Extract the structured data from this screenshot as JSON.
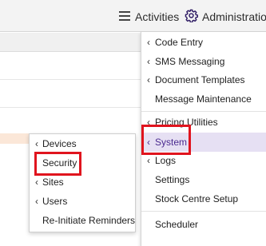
{
  "topbar": {
    "activities": {
      "label": "Activities",
      "icon": "list-icon"
    },
    "administration": {
      "label": "Administration",
      "icon": "gear-icon"
    }
  },
  "admin_menu": {
    "items": [
      {
        "label": "Code Entry",
        "has_submenu": true
      },
      {
        "label": "SMS Messaging",
        "has_submenu": true
      },
      {
        "label": "Document Templates",
        "has_submenu": true
      },
      {
        "label": "Message Maintenance",
        "has_submenu": false
      },
      {
        "label": "Pricing Utilities",
        "has_submenu": true
      },
      {
        "label": "System",
        "has_submenu": true,
        "highlighted": true
      },
      {
        "label": "Logs",
        "has_submenu": true
      },
      {
        "label": "Settings",
        "has_submenu": false
      },
      {
        "label": "Stock Centre Setup",
        "has_submenu": false
      },
      {
        "label": "Scheduler",
        "has_submenu": false
      }
    ]
  },
  "system_submenu": {
    "items": [
      {
        "label": "Devices",
        "has_submenu": true
      },
      {
        "label": "Security",
        "has_submenu": false
      },
      {
        "label": "Sites",
        "has_submenu": true
      },
      {
        "label": "Users",
        "has_submenu": true
      },
      {
        "label": "Re-Initiate Reminders",
        "has_submenu": false
      }
    ]
  },
  "colors": {
    "highlight_bg": "#e6e0f3",
    "highlight_text": "#4a2a8f",
    "annotation_box": "#e0141e"
  }
}
